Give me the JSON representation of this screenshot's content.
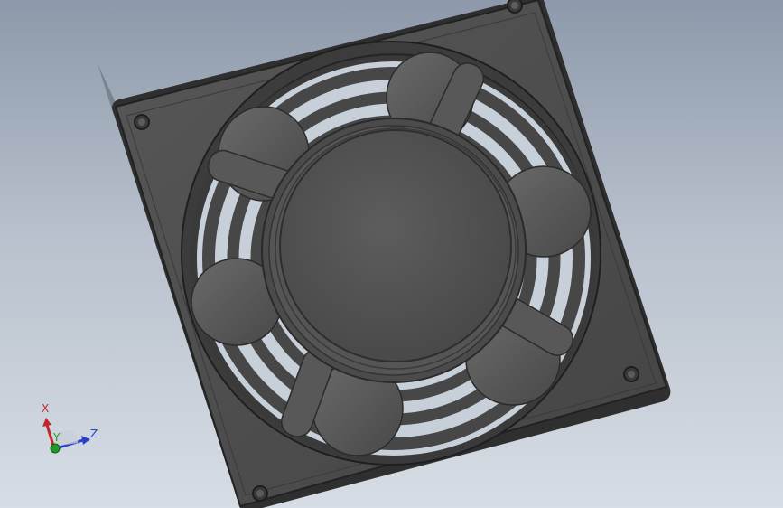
{
  "viewport": {
    "model": "fan-assembly",
    "colors": {
      "background_top": "#8d99aa",
      "background_bottom": "#d7dde4",
      "frame": "#4f4f4f",
      "frame_edge": "#2a2a2a",
      "blade": "#5a5a5a",
      "hub": "#545454"
    }
  },
  "triad": {
    "x_label": "X",
    "y_label": "Y",
    "z_label": "Z",
    "colors": {
      "x": "#c0262b",
      "y": "#1f9a2b",
      "z": "#2840c8"
    }
  }
}
